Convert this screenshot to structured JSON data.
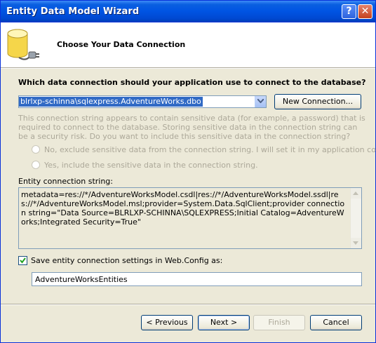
{
  "window": {
    "title": "Entity Data Model Wizard"
  },
  "header": {
    "title": "Choose Your Data Connection",
    "icon": "database-plug-icon"
  },
  "connection": {
    "question": "Which data connection should your application use to connect to the database?",
    "selected": "blrlxp-schinna\\sqlexpress.AdventureWorks.dbo",
    "new_connection_label": "New Connection..."
  },
  "warning": {
    "text": "This connection string appears to contain sensitive data (for example, a password) that is required to connect to the database. Storing sensitive data in the connection string can be a security risk. Do you want to include this sensitive data in the connection string?",
    "option_no": "No, exclude sensitive data from the connection string. I will set it in my application code.",
    "option_yes": "Yes, include the sensitive data in the connection string."
  },
  "entity_connection": {
    "label": "Entity connection string:",
    "value": "metadata=res://*/AdventureWorksModel.csdl|res://*/AdventureWorksModel.ssdl|res://*/AdventureWorksModel.msl;provider=System.Data.SqlClient;provider connection string=\"Data Source=BLRLXP-SCHINNA\\SQLEXPRESS;Initial Catalog=AdventureWorks;Integrated Security=True\""
  },
  "save_settings": {
    "checked": true,
    "label": "Save entity connection settings in Web.Config as:",
    "name": "AdventureWorksEntities"
  },
  "buttons": {
    "previous": "< Previous",
    "next": "Next >",
    "finish": "Finish",
    "cancel": "Cancel"
  },
  "colors": {
    "titlebar": "#0054e3",
    "selection": "#316ac5",
    "disabled_text": "#aca899",
    "dialog_bg": "#ece9d8"
  }
}
